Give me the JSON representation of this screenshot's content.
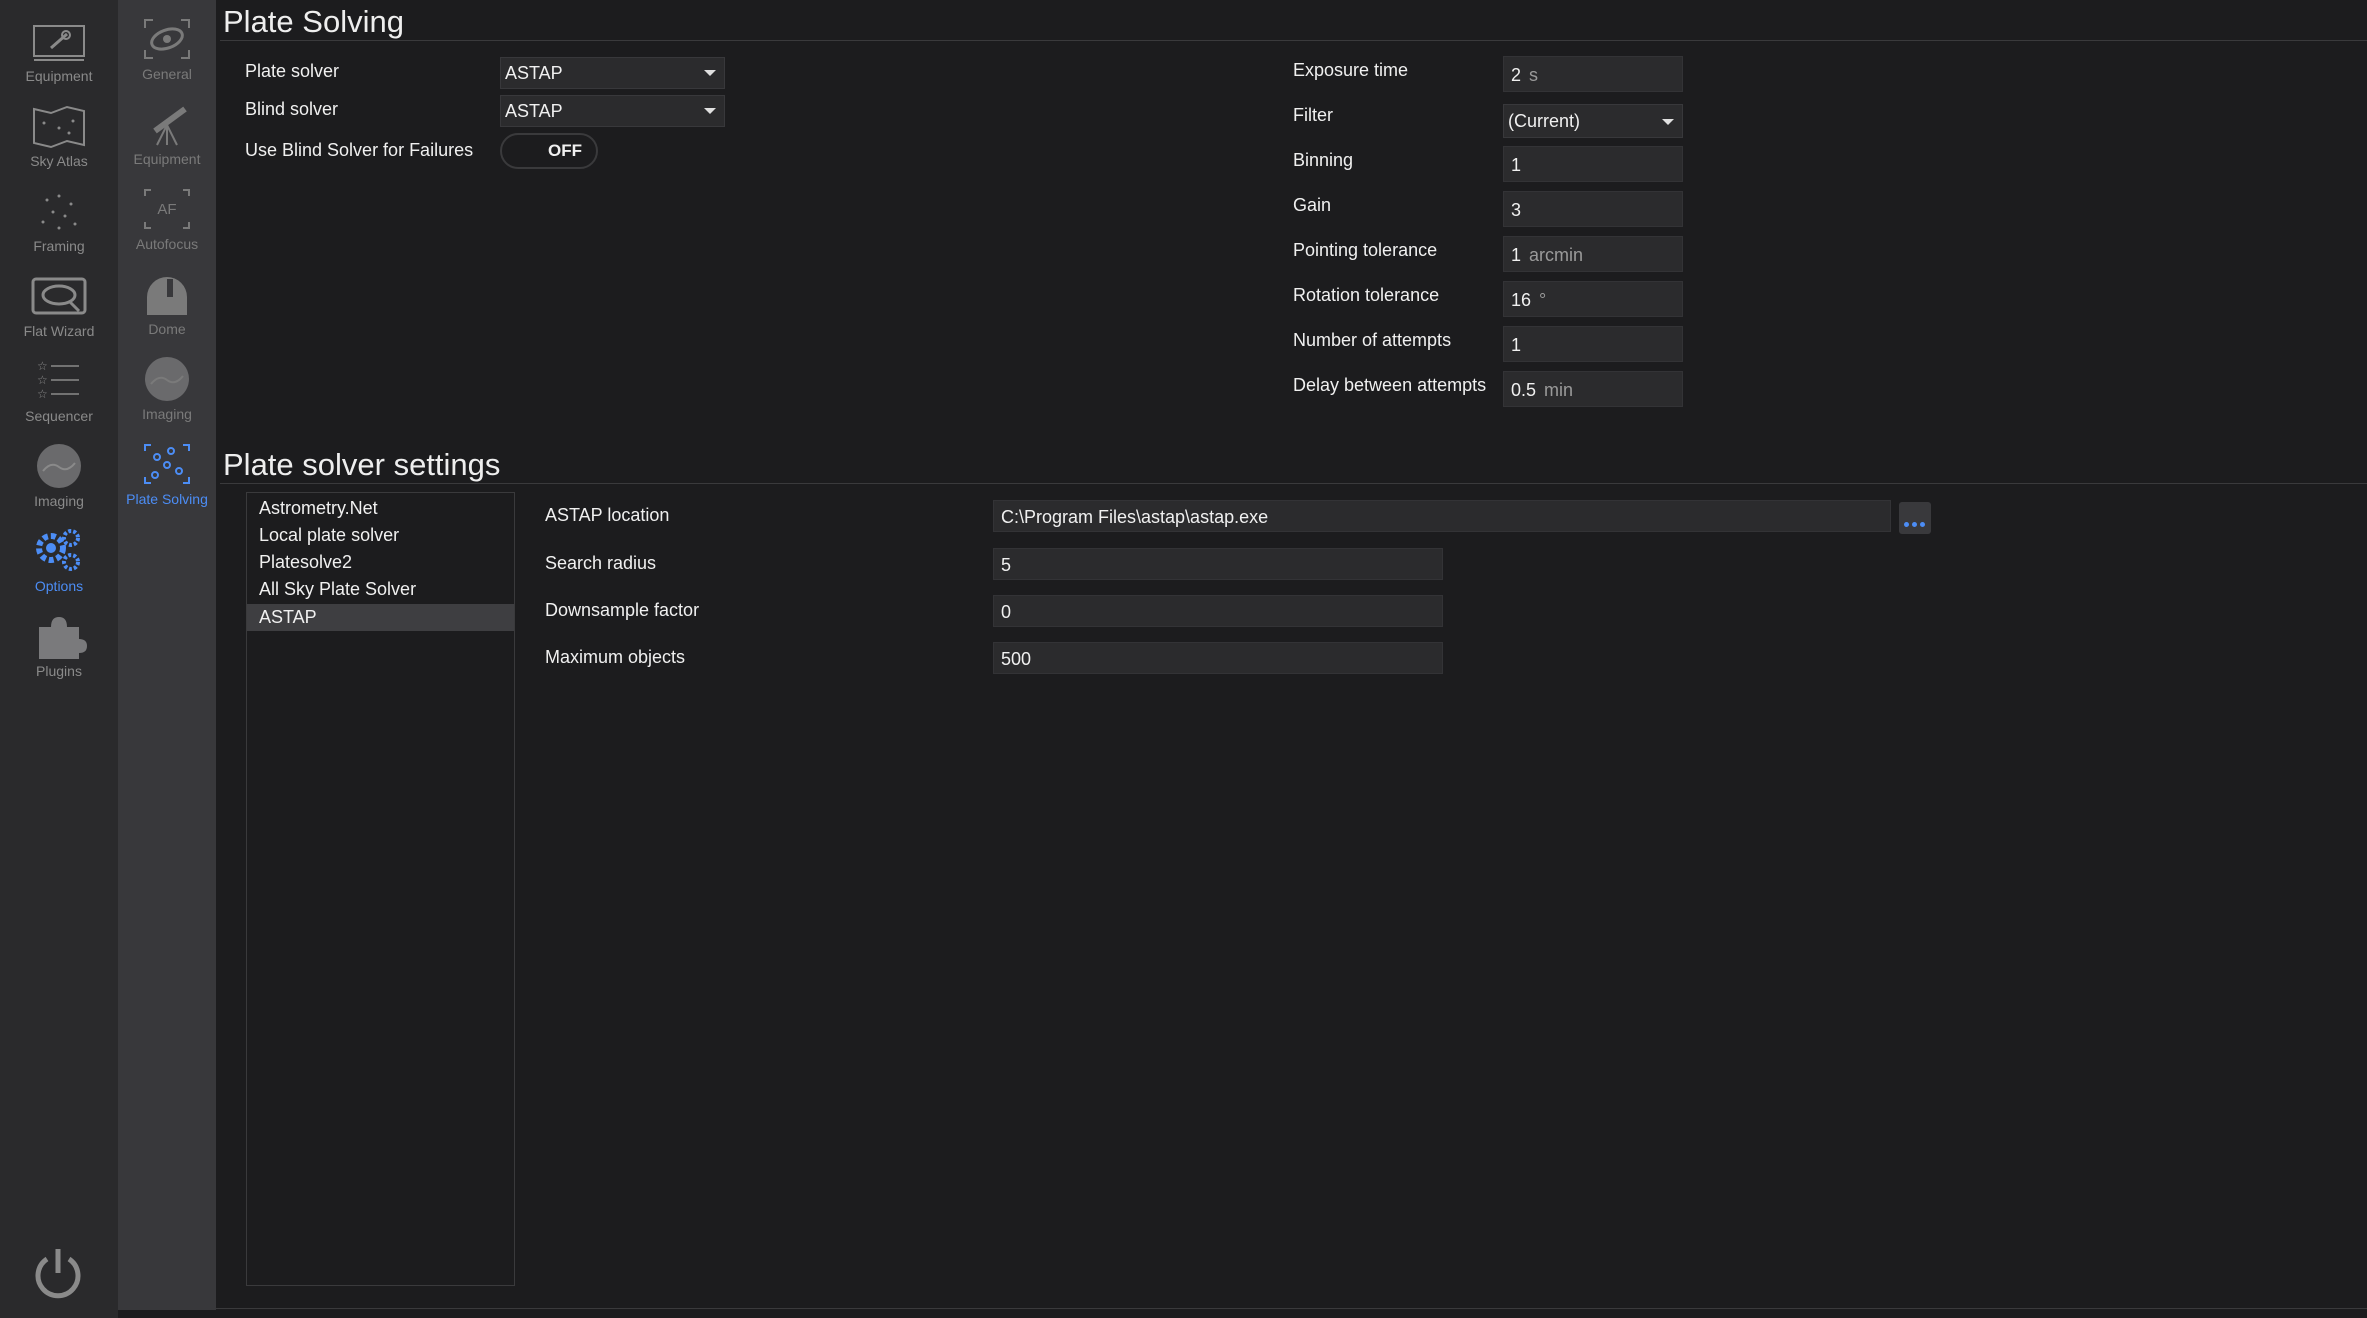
{
  "nav_primary": [
    {
      "label": "Equipment",
      "icon": "camera-icon"
    },
    {
      "label": "Sky Atlas",
      "icon": "sky-atlas-icon"
    },
    {
      "label": "Framing",
      "icon": "framing-icon"
    },
    {
      "label": "Flat Wizard",
      "icon": "flat-wizard-icon"
    },
    {
      "label": "Sequencer",
      "icon": "sequencer-icon"
    },
    {
      "label": "Imaging",
      "icon": "imaging-icon"
    },
    {
      "label": "Options",
      "icon": "gears-icon",
      "active": true
    },
    {
      "label": "Plugins",
      "icon": "puzzle-icon"
    }
  ],
  "nav_secondary": [
    {
      "label": "General",
      "icon": "general-icon"
    },
    {
      "label": "Equipment",
      "icon": "telescope-icon"
    },
    {
      "label": "Autofocus",
      "icon": "autofocus-icon"
    },
    {
      "label": "Dome",
      "icon": "dome-icon"
    },
    {
      "label": "Imaging",
      "icon": "imaging-icon"
    },
    {
      "label": "Plate Solving",
      "icon": "plate-solving-icon",
      "active": true
    }
  ],
  "plate_solving": {
    "title": "Plate Solving",
    "plate_solver_label": "Plate solver",
    "plate_solver_value": "ASTAP",
    "blind_solver_label": "Blind solver",
    "blind_solver_value": "ASTAP",
    "use_blind_label": "Use Blind Solver for Failures",
    "use_blind_value": "OFF",
    "exposure_label": "Exposure time",
    "exposure_value": "2",
    "exposure_unit": "s",
    "filter_label": "Filter",
    "filter_value": "(Current)",
    "binning_label": "Binning",
    "binning_value": "1",
    "gain_label": "Gain",
    "gain_value": "3",
    "pointing_label": "Pointing tolerance",
    "pointing_value": "1",
    "pointing_unit": "arcmin",
    "rotation_label": "Rotation tolerance",
    "rotation_value": "16",
    "rotation_unit": "°",
    "attempts_label": "Number of attempts",
    "attempts_value": "1",
    "delay_label": "Delay between attempts",
    "delay_value": "0.5",
    "delay_unit": "min"
  },
  "solver_settings": {
    "title": "Plate solver settings",
    "solvers": [
      "Astrometry.Net",
      "Local plate solver",
      "Platesolve2",
      "All Sky Plate Solver",
      "ASTAP"
    ],
    "selected_index": 4,
    "astap_location_label": "ASTAP location",
    "astap_location_value": "C:\\Program Files\\astap\\astap.exe",
    "search_radius_label": "Search radius",
    "search_radius_value": "5",
    "downsample_label": "Downsample factor",
    "downsample_value": "0",
    "max_objects_label": "Maximum objects",
    "max_objects_value": "500"
  },
  "colors": {
    "accent": "#4c8df5",
    "background": "#1c1c1e",
    "sidebar": "#2a2a2c",
    "subnav": "#38383b"
  }
}
